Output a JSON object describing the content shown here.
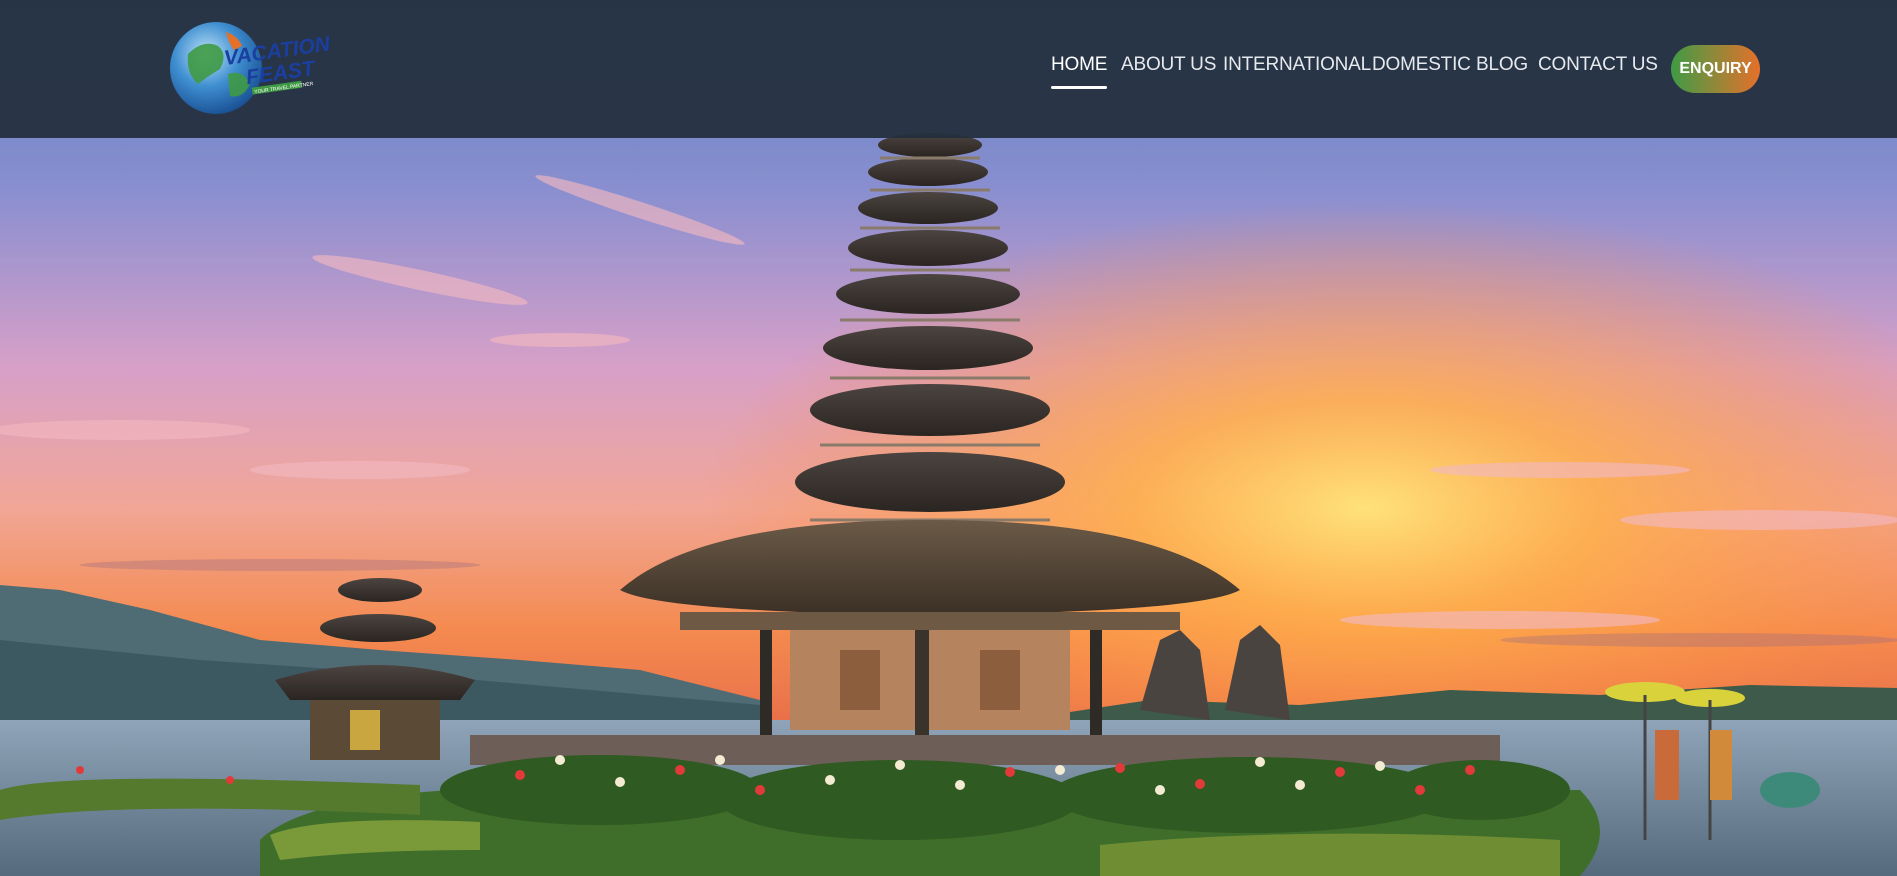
{
  "brand": {
    "logo_line1": "VACATION",
    "logo_line2": "FEAST",
    "logo_tagline": "YOUR TRAVEL PARTNER"
  },
  "nav": {
    "items": [
      {
        "label": "HOME",
        "active": true
      },
      {
        "label": "ABOUT US",
        "active": false
      },
      {
        "label": "INTERNATIONAL",
        "active": false
      },
      {
        "label": "DOMESTIC",
        "active": false
      },
      {
        "label": "BLOG",
        "active": false
      },
      {
        "label": "CONTACT US",
        "active": false
      }
    ],
    "enquiry_label": "ENQUIRY"
  },
  "colors": {
    "navbar": "#24303e",
    "enquiry_start": "#3f9a45",
    "enquiry_end": "#e5702a",
    "sky_top": "#6a88c4",
    "sunset": "#f5a640"
  },
  "hero": {
    "image": "bali-temple-lake-sunset"
  }
}
